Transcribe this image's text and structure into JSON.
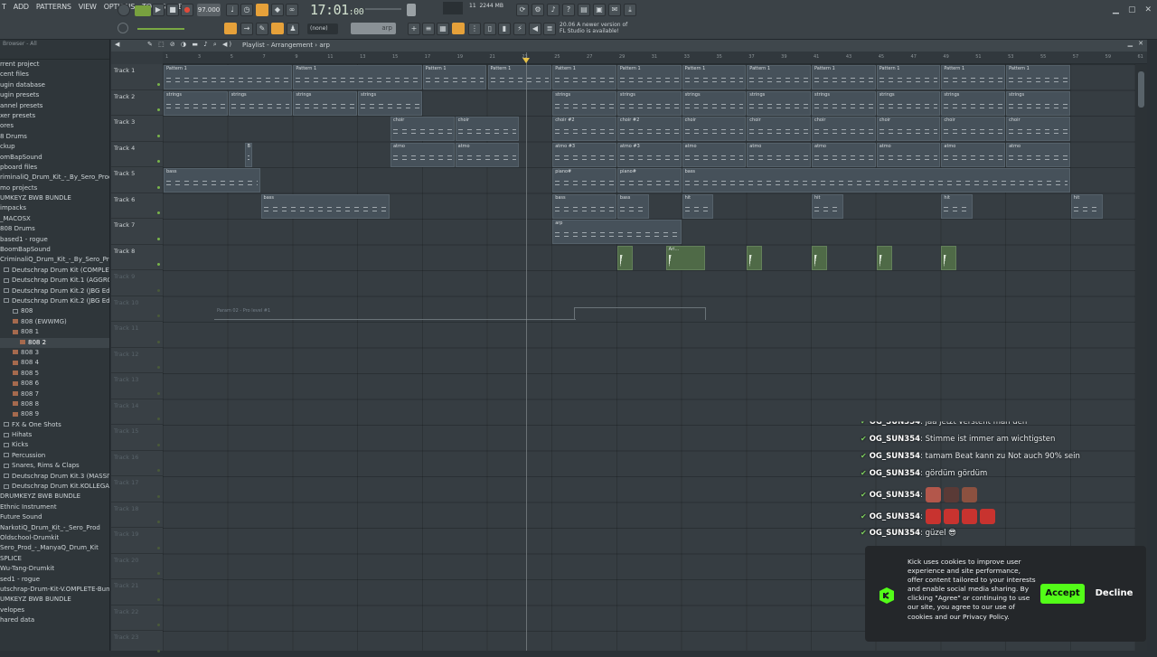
{
  "menu": [
    "T",
    "ADD",
    "PATTERNS",
    "VIEW",
    "OPTIONS",
    "TOOLS",
    "HELP"
  ],
  "toolbar": {
    "bpm": "97.000",
    "time": "17:01",
    "time_ticks": ":00",
    "cpu": "11",
    "memory": "2244 MB",
    "snap": "(none)",
    "pattern": "arp",
    "hint": "A newer version of FL Studio is available!",
    "hint_prefix": "20.06"
  },
  "browser": {
    "header": "Browser - All",
    "items": [
      {
        "label": "rrent project",
        "type": "folder"
      },
      {
        "label": "cent files",
        "type": "folder"
      },
      {
        "label": "ugin database",
        "type": "folder"
      },
      {
        "label": "ugin presets",
        "type": "folder"
      },
      {
        "label": "annel presets",
        "type": "folder"
      },
      {
        "label": "xer presets",
        "type": "folder"
      },
      {
        "label": "ores",
        "type": "folder"
      },
      {
        "label": "8 Drums",
        "type": "folder"
      },
      {
        "label": "ckup",
        "type": "folder"
      },
      {
        "label": "omBapSound",
        "type": "folder"
      },
      {
        "label": "pboard files",
        "type": "folder"
      },
      {
        "label": "riminaliQ_Drum_Kit_-_By_Sero_Prod",
        "type": "folder"
      },
      {
        "label": "mo projects",
        "type": "folder"
      },
      {
        "label": "UMKEYZ BWB BUNDLE",
        "type": "folder"
      },
      {
        "label": "impacks",
        "type": "folder"
      },
      {
        "label": "_MACOSX",
        "type": "folder"
      },
      {
        "label": "808 Drums",
        "type": "folder"
      },
      {
        "label": "based1 - rogue",
        "type": "folder"
      },
      {
        "label": "BoomBapSound",
        "type": "folder"
      },
      {
        "label": "CriminaliQ_Drum_Kit_-_By_Sero_Prod",
        "type": "folder"
      },
      {
        "label": "Deutschrap Drum Kit (COMPLETE Bundle)",
        "type": "folder"
      },
      {
        "label": "Deutschrap Drum Kit.1 (AGGRO Edition)",
        "type": "folder"
      },
      {
        "label": "Deutschrap Drum Kit.2 (JBG Edition)",
        "type": "folder"
      },
      {
        "label": "Deutschrap Drum Kit.2 (JBG Edition)",
        "type": "folder"
      },
      {
        "label": "808",
        "type": "folder"
      },
      {
        "label": "808 (EWWMG)",
        "type": "file"
      },
      {
        "label": "808 1",
        "type": "file"
      },
      {
        "label": "808 2",
        "type": "file",
        "selected": true
      },
      {
        "label": "808 3",
        "type": "file"
      },
      {
        "label": "808 4",
        "type": "file"
      },
      {
        "label": "808 5",
        "type": "file"
      },
      {
        "label": "808 6",
        "type": "file"
      },
      {
        "label": "808 7",
        "type": "file"
      },
      {
        "label": "808 8",
        "type": "file"
      },
      {
        "label": "808 9",
        "type": "file"
      },
      {
        "label": "FX & One Shots",
        "type": "folder"
      },
      {
        "label": "Hihats",
        "type": "folder"
      },
      {
        "label": "Kicks",
        "type": "folder"
      },
      {
        "label": "Percussion",
        "type": "folder"
      },
      {
        "label": "Snares, Rims & Claps",
        "type": "folder"
      },
      {
        "label": "Deutschrap Drum Kit.3 (MASSIV Edition)",
        "type": "folder"
      },
      {
        "label": "Deutschrap Drum Kit.KOLLEGAH Edition)",
        "type": "folder"
      },
      {
        "label": "DRUMKEYZ BWB BUNDLE",
        "type": "folder"
      },
      {
        "label": "Ethnic Instrument",
        "type": "folder"
      },
      {
        "label": "Future Sound",
        "type": "folder"
      },
      {
        "label": "NarkotiQ_Drum_Kit_-_Sero_Prod",
        "type": "folder"
      },
      {
        "label": "Oldschool-Drumkit",
        "type": "folder"
      },
      {
        "label": "Sero_Prod_-_ManyaQ_Drum_Kit",
        "type": "folder"
      },
      {
        "label": "SPLICE",
        "type": "folder"
      },
      {
        "label": "Wu-Tang-Drumkit",
        "type": "folder"
      },
      {
        "label": "sed1 - rogue",
        "type": "folder"
      },
      {
        "label": "utschrap-Drum-Kit-V.OMPLETE-Bundle-aufpck",
        "type": "folder"
      },
      {
        "label": "UMKEYZ BWB BUNDLE",
        "type": "folder"
      },
      {
        "label": "velopes",
        "type": "folder"
      },
      {
        "label": "hared data",
        "type": "folder"
      }
    ]
  },
  "playlist": {
    "title": "Playlist - Arrangement",
    "pattern": "arp",
    "ruler": [
      "1",
      "3",
      "5",
      "7",
      "9",
      "11",
      "13",
      "15",
      "17",
      "19",
      "21",
      "23",
      "25",
      "27",
      "29",
      "31",
      "33",
      "35",
      "37",
      "39",
      "41",
      "43",
      "45",
      "47",
      "49",
      "51",
      "53",
      "55",
      "57",
      "59",
      "61"
    ],
    "tracks": [
      "Track 1",
      "Track 2",
      "Track 3",
      "Track 4",
      "Track 5",
      "Track 6",
      "Track 7",
      "Track 8",
      "Track 9",
      "Track 10",
      "Track 11",
      "Track 12",
      "Track 13",
      "Track 14",
      "Track 15",
      "Track 16",
      "Track 17",
      "Track 18",
      "Track 19",
      "Track 20",
      "Track 21",
      "Track 22",
      "Track 23"
    ],
    "clips": [
      {
        "row": 0,
        "bar": 1,
        "len": 8,
        "label": "Pattern 1"
      },
      {
        "row": 0,
        "bar": 9,
        "len": 8,
        "label": "Pattern 1"
      },
      {
        "row": 0,
        "bar": 17,
        "len": 4,
        "label": "Pattern 1"
      },
      {
        "row": 0,
        "bar": 21,
        "len": 4,
        "label": "Pattern 1"
      },
      {
        "row": 0,
        "bar": 25,
        "len": 4,
        "label": "Pattern 1"
      },
      {
        "row": 0,
        "bar": 29,
        "len": 4,
        "label": "Pattern 1"
      },
      {
        "row": 0,
        "bar": 33,
        "len": 4,
        "label": "Pattern 1"
      },
      {
        "row": 0,
        "bar": 37,
        "len": 4,
        "label": "Pattern 1"
      },
      {
        "row": 0,
        "bar": 41,
        "len": 4,
        "label": "Pattern 1"
      },
      {
        "row": 0,
        "bar": 45,
        "len": 4,
        "label": "Pattern 1"
      },
      {
        "row": 0,
        "bar": 49,
        "len": 4,
        "label": "Pattern 1"
      },
      {
        "row": 0,
        "bar": 53,
        "len": 4,
        "label": "Pattern 1"
      },
      {
        "row": 1,
        "bar": 1,
        "len": 4,
        "label": "strings"
      },
      {
        "row": 1,
        "bar": 5,
        "len": 4,
        "label": "strings"
      },
      {
        "row": 1,
        "bar": 9,
        "len": 4,
        "label": "strings"
      },
      {
        "row": 1,
        "bar": 13,
        "len": 4,
        "label": "strings"
      },
      {
        "row": 1,
        "bar": 25,
        "len": 4,
        "label": "strings"
      },
      {
        "row": 1,
        "bar": 29,
        "len": 4,
        "label": "strings"
      },
      {
        "row": 1,
        "bar": 33,
        "len": 4,
        "label": "strings"
      },
      {
        "row": 1,
        "bar": 37,
        "len": 4,
        "label": "strings"
      },
      {
        "row": 1,
        "bar": 41,
        "len": 4,
        "label": "strings"
      },
      {
        "row": 1,
        "bar": 45,
        "len": 4,
        "label": "strings"
      },
      {
        "row": 1,
        "bar": 49,
        "len": 4,
        "label": "strings"
      },
      {
        "row": 1,
        "bar": 53,
        "len": 4,
        "label": "strings"
      },
      {
        "row": 2,
        "bar": 15,
        "len": 4,
        "label": "choir"
      },
      {
        "row": 2,
        "bar": 19,
        "len": 4,
        "label": "choir"
      },
      {
        "row": 2,
        "bar": 25,
        "len": 4,
        "label": "choir #2"
      },
      {
        "row": 2,
        "bar": 29,
        "len": 4,
        "label": "choir #2"
      },
      {
        "row": 2,
        "bar": 33,
        "len": 4,
        "label": "choir"
      },
      {
        "row": 2,
        "bar": 37,
        "len": 4,
        "label": "choir"
      },
      {
        "row": 2,
        "bar": 41,
        "len": 4,
        "label": "choir"
      },
      {
        "row": 2,
        "bar": 45,
        "len": 4,
        "label": "choir"
      },
      {
        "row": 2,
        "bar": 49,
        "len": 4,
        "label": "choir"
      },
      {
        "row": 2,
        "bar": 53,
        "len": 4,
        "label": "choir"
      },
      {
        "row": 3,
        "bar": 6,
        "len": 0.5,
        "label": "B"
      },
      {
        "row": 3,
        "bar": 15,
        "len": 4,
        "label": "atmo"
      },
      {
        "row": 3,
        "bar": 19,
        "len": 4,
        "label": "atmo"
      },
      {
        "row": 3,
        "bar": 25,
        "len": 4,
        "label": "atmo #3"
      },
      {
        "row": 3,
        "bar": 29,
        "len": 4,
        "label": "atmo #3"
      },
      {
        "row": 3,
        "bar": 33,
        "len": 4,
        "label": "atmo"
      },
      {
        "row": 3,
        "bar": 37,
        "len": 4,
        "label": "atmo"
      },
      {
        "row": 3,
        "bar": 41,
        "len": 4,
        "label": "atmo"
      },
      {
        "row": 3,
        "bar": 45,
        "len": 4,
        "label": "atmo"
      },
      {
        "row": 3,
        "bar": 49,
        "len": 4,
        "label": "atmo"
      },
      {
        "row": 3,
        "bar": 53,
        "len": 4,
        "label": "atmo"
      },
      {
        "row": 4,
        "bar": 1,
        "len": 6,
        "label": "bass"
      },
      {
        "row": 4,
        "bar": 25,
        "len": 4,
        "label": "piano#"
      },
      {
        "row": 4,
        "bar": 29,
        "len": 4,
        "label": "piano#"
      },
      {
        "row": 4,
        "bar": 33,
        "len": 24,
        "label": "bass"
      },
      {
        "row": 5,
        "bar": 7,
        "len": 8,
        "label": "bass"
      },
      {
        "row": 5,
        "bar": 25,
        "len": 4,
        "label": "bass"
      },
      {
        "row": 5,
        "bar": 29,
        "len": 2,
        "label": "bass"
      },
      {
        "row": 5,
        "bar": 33,
        "len": 2,
        "label": "hit"
      },
      {
        "row": 5,
        "bar": 41,
        "len": 2,
        "label": "hit"
      },
      {
        "row": 5,
        "bar": 49,
        "len": 2,
        "label": "hit"
      },
      {
        "row": 5,
        "bar": 57,
        "len": 2,
        "label": "hit"
      },
      {
        "row": 6,
        "bar": 25,
        "len": 8,
        "label": "arp"
      },
      {
        "row": 7,
        "bar": 29,
        "len": 1,
        "label": "",
        "audio": true
      },
      {
        "row": 7,
        "bar": 32,
        "len": 2.5,
        "label": "Ari...",
        "audio": true
      },
      {
        "row": 7,
        "bar": 37,
        "len": 1,
        "label": "",
        "audio": true
      },
      {
        "row": 7,
        "bar": 41,
        "len": 1,
        "label": "",
        "audio": true
      },
      {
        "row": 7,
        "bar": 45,
        "len": 1,
        "label": "",
        "audio": true
      },
      {
        "row": 7,
        "bar": 49,
        "len": 1,
        "label": "",
        "audio": true
      }
    ],
    "automation_label": "Param 02 - Pro level #1"
  },
  "chat": {
    "messages": [
      {
        "user": "OG_SUN354",
        "text": "jaa jetzt versteht man den"
      },
      {
        "user": "OG_SUN354",
        "text": "Stimme ist immer am wichtigsten"
      },
      {
        "user": "OG_SUN354",
        "text": "tamam Beat kann zu Not auch 90% sein"
      },
      {
        "user": "OG_SUN354",
        "text": "gördüm gördüm"
      },
      {
        "user": "OG_SUN354",
        "text": ""
      },
      {
        "user": "OG_SUN354",
        "text": ""
      },
      {
        "user": "OG_SUN354",
        "text": "güzel 😎"
      }
    ],
    "emote_colors_row1": [
      "#b3574b",
      "#5a3a36",
      "#8c5140"
    ],
    "emote_colors_row2": [
      "#c8332f",
      "#c8332f",
      "#c8332f",
      "#c8332f"
    ]
  },
  "cookie": {
    "text": "Kick uses cookies to improve user experience and site performance, offer content tailored to your interests and enable social media sharing. By clicking \"Agree\" or continuing to use our site, you agree to our use of cookies and our Privacy Policy.",
    "accept": "Accept",
    "decline": "Decline",
    "accent": "#53fc18"
  }
}
